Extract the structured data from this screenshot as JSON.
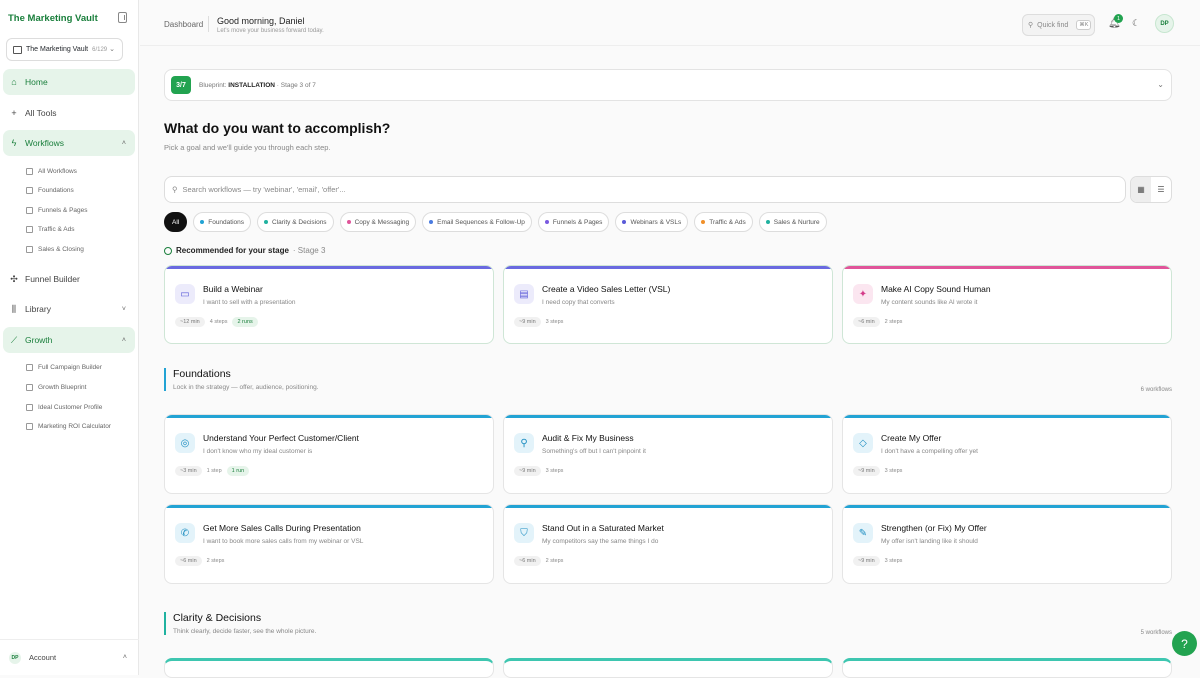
{
  "sidebar": {
    "brand": "The Marketing Vault",
    "workspace": {
      "name": "The Marketing Vault",
      "count": "6/129"
    },
    "home": "Home",
    "all_tools": "All Tools",
    "workflows": "Workflows",
    "workflows_sub": [
      "All Workflows",
      "Foundations",
      "Funnels & Pages",
      "Traffic & Ads",
      "Sales & Closing"
    ],
    "funnel_builder": "Funnel Builder",
    "library": "Library",
    "growth": "Growth",
    "growth_sub": [
      "Full Campaign Builder",
      "Growth Blueprint",
      "Ideal Customer Profile",
      "Marketing ROI Calculator"
    ],
    "account": {
      "initials": "DP",
      "label": "Account"
    }
  },
  "header": {
    "breadcrumb": "Dashboard",
    "greeting": "Good morning, Daniel",
    "greeting_sub": "Let's move your business forward today.",
    "quick_find": "Quick find",
    "quick_find_kbd": "⌘K",
    "notifications": "1",
    "avatar": "DP"
  },
  "blueprint": {
    "badge": "3/7",
    "prefix": "Blueprint:",
    "name": "INSTALLATION",
    "stage": "· Stage 3 of 7"
  },
  "hero": {
    "title": "What do you want to accomplish?",
    "subtitle": "Pick a goal and we'll guide you through each step."
  },
  "search": {
    "placeholder": "Search workflows — try 'webinar', 'email', 'offer'..."
  },
  "chips": [
    {
      "label": "All",
      "color": ""
    },
    {
      "label": "Foundations",
      "color": "#22a3d4"
    },
    {
      "label": "Clarity & Decisions",
      "color": "#20b2a0"
    },
    {
      "label": "Copy & Messaging",
      "color": "#e0559a"
    },
    {
      "label": "Email Sequences & Follow-Up",
      "color": "#4a7be0"
    },
    {
      "label": "Funnels & Pages",
      "color": "#7a5ae0"
    },
    {
      "label": "Webinars & VSLs",
      "color": "#5a5ad8"
    },
    {
      "label": "Traffic & Ads",
      "color": "#f0902a"
    },
    {
      "label": "Sales & Nurture",
      "color": "#20b2a0"
    }
  ],
  "recommended": {
    "label": "Recommended for your stage",
    "stage": "· Stage 3",
    "cards": [
      {
        "title": "Build a Webinar",
        "desc": "I want to sell with a presentation",
        "time": "~12 min",
        "steps": "4 steps",
        "runs": "2 runs",
        "color": "#6a6ae0",
        "icon": "presentation-icon",
        "glyph": "▭"
      },
      {
        "title": "Create a Video Sales Letter (VSL)",
        "desc": "I need copy that converts",
        "time": "~9 min",
        "steps": "3 steps",
        "runs": "",
        "color": "#6a6ae0",
        "icon": "document-icon",
        "glyph": "▤"
      },
      {
        "title": "Make AI Copy Sound Human",
        "desc": "My content sounds like AI wrote it",
        "time": "~6 min",
        "steps": "2 steps",
        "runs": "",
        "color": "#e0559a",
        "icon": "sparkle-icon",
        "glyph": "✦"
      }
    ]
  },
  "foundations": {
    "title": "Foundations",
    "subtitle": "Lock in the strategy — offer, audience, positioning.",
    "count": "6 workflows",
    "cards": [
      {
        "title": "Understand Your Perfect Customer/Client",
        "desc": "I don't know who my ideal customer is",
        "time": "~3 min",
        "steps": "1 step",
        "runs": "1 run",
        "icon": "target-icon",
        "glyph": "◎"
      },
      {
        "title": "Audit & Fix My Business",
        "desc": "Something's off but I can't pinpoint it",
        "time": "~9 min",
        "steps": "3 steps",
        "runs": "",
        "icon": "search-icon",
        "glyph": "⚲"
      },
      {
        "title": "Create My Offer",
        "desc": "I don't have a compelling offer yet",
        "time": "~9 min",
        "steps": "3 steps",
        "runs": "",
        "icon": "diamond-icon",
        "glyph": "◇"
      },
      {
        "title": "Get More Sales Calls During Presentation",
        "desc": "I want to book more sales calls from my webinar or VSL",
        "time": "~6 min",
        "steps": "2 steps",
        "runs": "",
        "icon": "phone-icon",
        "glyph": "✆"
      },
      {
        "title": "Stand Out in a Saturated Market",
        "desc": "My competitors say the same things I do",
        "time": "~6 min",
        "steps": "2 steps",
        "runs": "",
        "icon": "shield-icon",
        "glyph": "⛉"
      },
      {
        "title": "Strengthen (or Fix) My Offer",
        "desc": "My offer isn't landing like it should",
        "time": "~9 min",
        "steps": "3 steps",
        "runs": "",
        "icon": "wrench-icon",
        "glyph": "✎"
      }
    ]
  },
  "clarity": {
    "title": "Clarity & Decisions",
    "subtitle": "Think clearly, decide faster, see the whole picture.",
    "count": "5 workflows"
  }
}
